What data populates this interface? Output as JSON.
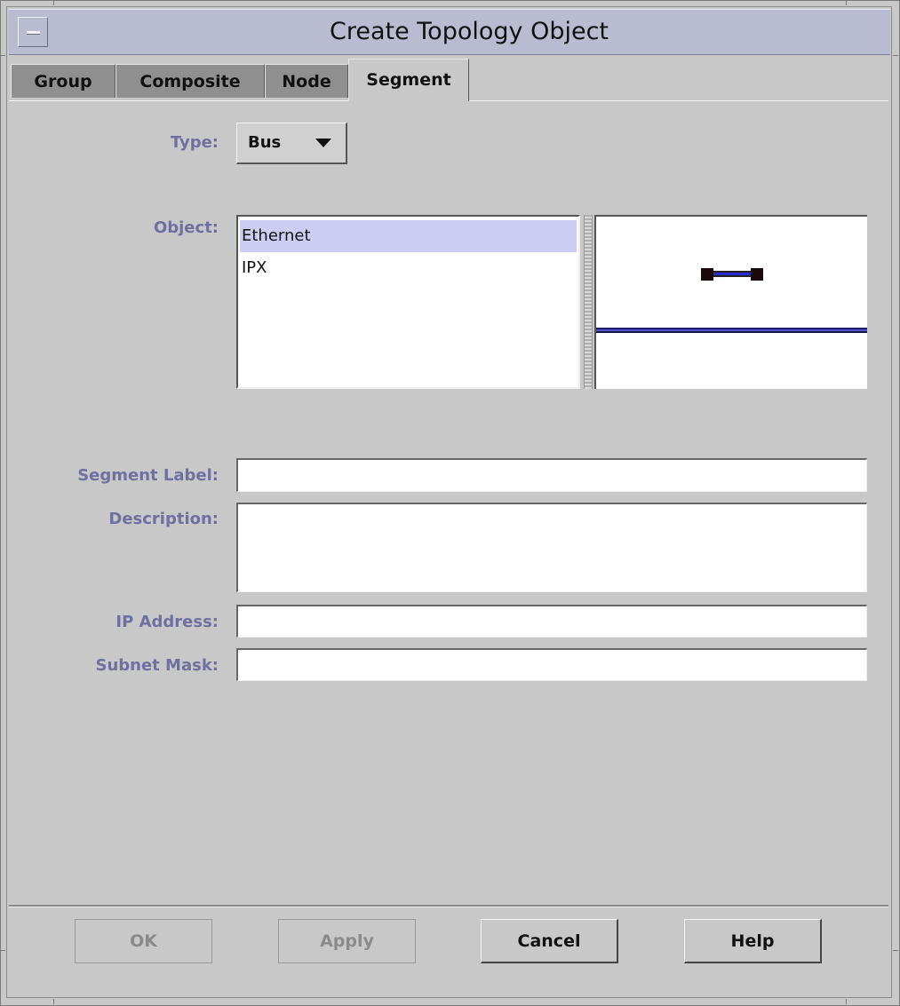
{
  "window": {
    "title": "Create Topology Object"
  },
  "tabs": [
    {
      "label": "Group"
    },
    {
      "label": "Composite"
    },
    {
      "label": "Node"
    },
    {
      "label": "Segment"
    }
  ],
  "active_tab": "Segment",
  "form": {
    "type_label": "Type:",
    "type_value": "Bus",
    "object_label": "Object:",
    "objects": [
      "Ethernet",
      "IPX"
    ],
    "selected_object": "Ethernet",
    "segment_label_label": "Segment Label:",
    "segment_label_value": "",
    "description_label": "Description:",
    "description_value": "",
    "ip_address_label": "IP Address:",
    "ip_address_value": "",
    "subnet_mask_label": "Subnet Mask:",
    "subnet_mask_value": ""
  },
  "buttons": {
    "ok": "OK",
    "apply": "Apply",
    "cancel": "Cancel",
    "help": "Help"
  },
  "colors": {
    "titlebar": "#b9bcd1",
    "label_text": "#6e70a0",
    "selection": "#cbcdf3",
    "bus_line": "#1a1a6e"
  },
  "icons": {
    "system_menu": "minus-bar-icon",
    "dropdown": "triangle-down-icon",
    "preview": "bus-segment-icon"
  }
}
